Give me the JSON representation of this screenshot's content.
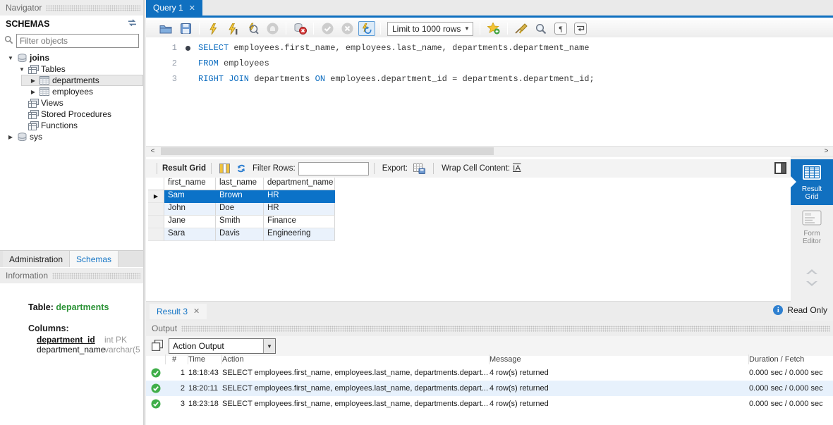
{
  "window": {
    "accent": "#1070c0",
    "selection_blue": "#0b72c8",
    "success_green": "#3fae49"
  },
  "navigator": {
    "header": "Navigator",
    "schemas_label": "SCHEMAS",
    "filter_placeholder": "Filter objects",
    "tree": [
      {
        "label": "joins",
        "icon": "schema-icon",
        "arrow": "exp",
        "level": 0,
        "bold": true
      },
      {
        "label": "Tables",
        "icon": "tables-icon",
        "arrow": "exp",
        "level": 1
      },
      {
        "label": "departments",
        "icon": "table-icon",
        "arrow": "col",
        "level": 2,
        "selected": true
      },
      {
        "label": "employees",
        "icon": "table-icon",
        "arrow": "col",
        "level": 2
      },
      {
        "label": "Views",
        "icon": "views-icon",
        "arrow": "none",
        "level": 1
      },
      {
        "label": "Stored Procedures",
        "icon": "procedures-icon",
        "arrow": "none",
        "level": 1
      },
      {
        "label": "Functions",
        "icon": "functions-icon",
        "arrow": "none",
        "level": 1
      },
      {
        "label": "sys",
        "icon": "schema-icon",
        "arrow": "col",
        "level": 0
      }
    ],
    "bottom_tabs": [
      {
        "label": "Administration",
        "active": false
      },
      {
        "label": "Schemas",
        "active": true
      }
    ]
  },
  "information": {
    "header": "Information",
    "table_label": "Table:",
    "table_name": "departments",
    "columns_label": "Columns:",
    "columns": [
      {
        "name": "department_id",
        "type": "int PK",
        "emphasis": true
      },
      {
        "name": "department_name",
        "type": "varchar(5",
        "emphasis": false
      }
    ]
  },
  "editor_tabs": [
    {
      "label": "Query 1",
      "active": true
    }
  ],
  "query_toolbar": {
    "limit_value": "Limit to 1000 rows"
  },
  "sql_editor": {
    "lines": [
      {
        "number": "1",
        "marker": true,
        "segments": [
          [
            "SELECT",
            1
          ],
          [
            " employees.first_name, employees.last_name, departments.department_name",
            0
          ]
        ]
      },
      {
        "number": "2",
        "marker": false,
        "segments": [
          [
            "FROM",
            1
          ],
          [
            " employees",
            0
          ]
        ]
      },
      {
        "number": "3",
        "marker": false,
        "segments": [
          [
            "RIGHT JOIN",
            1
          ],
          [
            " departments ",
            0
          ],
          [
            "ON",
            1
          ],
          [
            " employees.department_id = departments.department_id;",
            0
          ]
        ]
      }
    ]
  },
  "result_grid_toolbar": {
    "title": "Result Grid",
    "filter_label": "Filter Rows:",
    "filter_value": "",
    "export_label": "Export:",
    "wrap_label": "Wrap Cell Content:",
    "wrap_icon_text": "IA"
  },
  "result_grid": {
    "columns": [
      "first_name",
      "last_name",
      "department_name"
    ],
    "rows": [
      {
        "cells": [
          "Sam",
          "Brown",
          "HR"
        ],
        "selected": true
      },
      {
        "cells": [
          "John",
          "Doe",
          "HR"
        ],
        "selected": false
      },
      {
        "cells": [
          "Jane",
          "Smith",
          "Finance"
        ],
        "selected": false
      },
      {
        "cells": [
          "Sara",
          "Davis",
          "Engineering"
        ],
        "selected": false
      }
    ]
  },
  "result_tabs": [
    {
      "label": "Result 3"
    }
  ],
  "read_only": {
    "label": "Read Only"
  },
  "side_panel": {
    "items": [
      {
        "label": "Result Grid",
        "active": true
      },
      {
        "label": "Form Editor",
        "active": false
      }
    ]
  },
  "output": {
    "header": "Output",
    "view_selector": "Action Output",
    "columns": [
      "#",
      "Time",
      "Action",
      "Message",
      "Duration / Fetch"
    ],
    "rows": [
      {
        "num": "1",
        "time": "18:18:43",
        "action": "SELECT employees.first_name, employees.last_name, departments.depart...",
        "message": "4 row(s) returned",
        "duration": "0.000 sec / 0.000 sec",
        "highlight": false
      },
      {
        "num": "2",
        "time": "18:20:11",
        "action": "SELECT employees.first_name, employees.last_name, departments.depart...",
        "message": "4 row(s) returned",
        "duration": "0.000 sec / 0.000 sec",
        "highlight": true
      },
      {
        "num": "3",
        "time": "18:23:18",
        "action": "SELECT employees.first_name, employees.last_name, departments.depart...",
        "message": "4 row(s) returned",
        "duration": "0.000 sec / 0.000 sec",
        "highlight": false
      }
    ]
  }
}
